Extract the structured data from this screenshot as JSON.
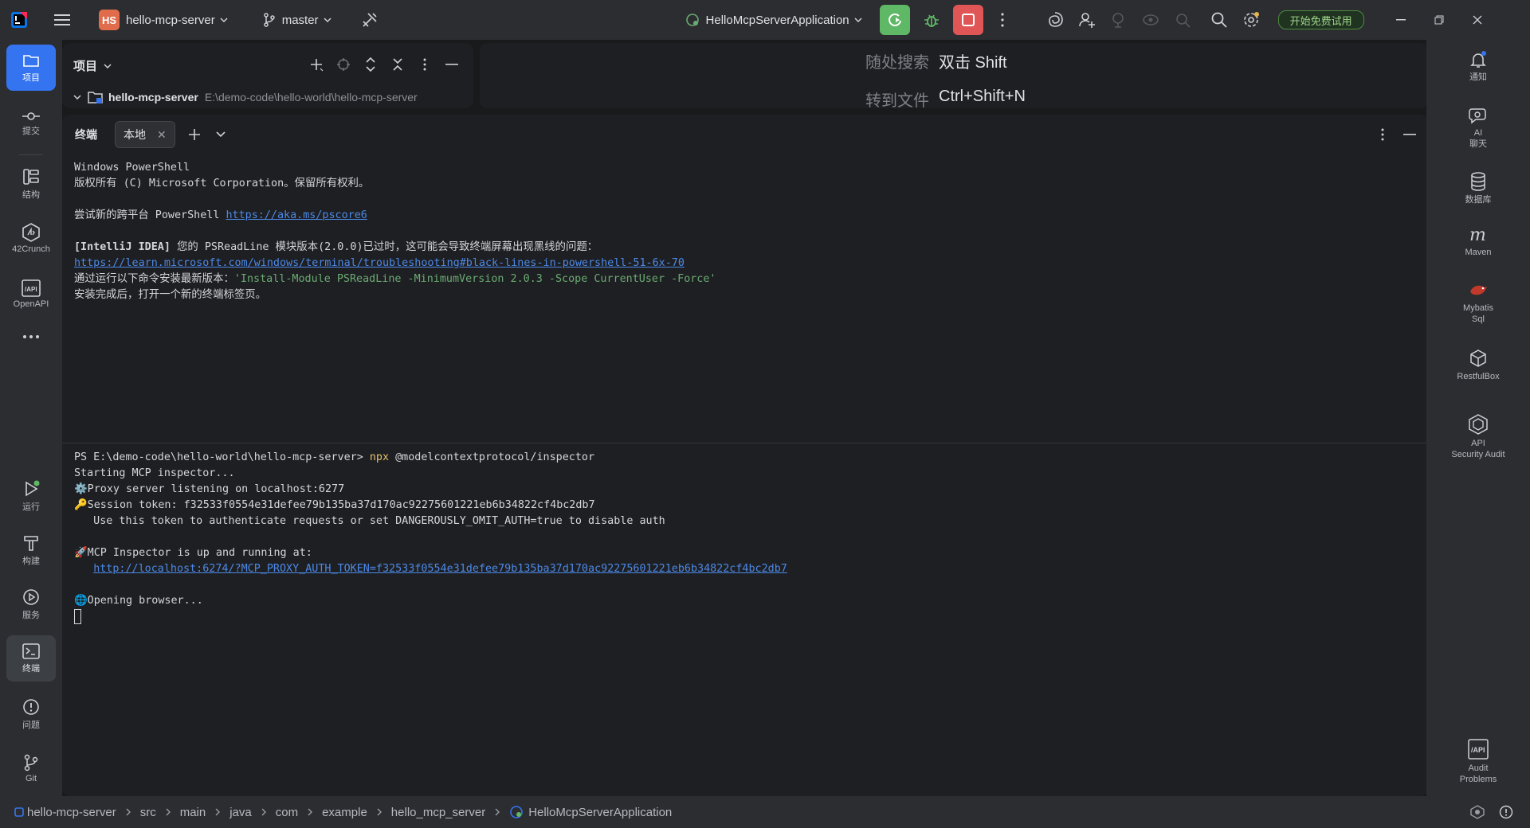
{
  "titlebar": {
    "project_badge": "HS",
    "project_name": "hello-mcp-server",
    "branch": "master",
    "run_config": "HelloMcpServerApplication",
    "trial_label": "开始免费试用"
  },
  "left_tools": {
    "project": "项目",
    "commit": "提交",
    "structure": "结构",
    "crunch": "42Crunch",
    "openapi": "OpenAPI",
    "run": "运行",
    "build": "构建",
    "services": "服务",
    "terminal": "终端",
    "problems": "问题",
    "git": "Git"
  },
  "right_tools": {
    "notifications": "通知",
    "ai_chat_1": "AI",
    "ai_chat_2": "聊天",
    "database": "数据库",
    "maven": "Maven",
    "mybatis_1": "Mybatis",
    "mybatis_2": "Sql",
    "restfulbox": "RestfulBox",
    "api_audit_1": "API",
    "api_audit_2": "Security Audit",
    "audit_problems_1": "Audit",
    "audit_problems_2": "Problems"
  },
  "project_panel": {
    "title": "项目",
    "root_name": "hello-mcp-server",
    "root_path": "E:\\demo-code\\hello-world\\hello-mcp-server"
  },
  "hints": {
    "search_label": "随处搜索",
    "search_key": "双击 Shift",
    "goto_label": "转到文件",
    "goto_key": "Ctrl+Shift+N"
  },
  "terminal": {
    "title": "终端",
    "tab_label": "本地",
    "line1": "Windows PowerShell",
    "line2": "版权所有 (C) Microsoft Corporation。保留所有权利。",
    "line3_text": "尝试新的跨平台 PowerShell ",
    "line3_link": "https://aka.ms/pscore6",
    "line4_bold": "[IntelliJ IDEA]",
    "line4_text": " 您的 PSReadLine 模块版本(2.0.0)已过时，这可能会导致终端屏幕出现黑线的问题：",
    "line5_link": "https://learn.microsoft.com/windows/terminal/troubleshooting#black-lines-in-powershell-51-6x-70",
    "line6_text": "通过运行以下命令安装最新版本：",
    "line6_str": "'Install-Module PSReadLine -MinimumVersion 2.0.3 -Scope CurrentUser -Force'",
    "line7": "安装完成后，打开一个新的终端标签页。",
    "prompt": "PS E:\\demo-code\\hello-world\\hello-mcp-server>",
    "cmd": "npx",
    "cmd_args": " @modelcontextprotocol/inspector",
    "out1": "Starting MCP inspector...",
    "out2": "⚙️Proxy server listening on localhost:6277",
    "out3": "🔑Session token: f32533f0554e31defee79b135ba37d170ac92275601221eb6b34822cf4bc2db7",
    "out4": "   Use this token to authenticate requests or set DANGEROUSLY_OMIT_AUTH=true to disable auth",
    "out5": "🚀MCP Inspector is up and running at:",
    "out6_link": "http://localhost:6274/?MCP_PROXY_AUTH_TOKEN=f32533f0554e31defee79b135ba37d170ac92275601221eb6b34822cf4bc2db7",
    "out7": "🌐Opening browser..."
  },
  "breadcrumb": [
    "hello-mcp-server",
    "src",
    "main",
    "java",
    "com",
    "example",
    "hello_mcp_server",
    "HelloMcpServerApplication"
  ],
  "colors": {
    "accent": "#3574f0",
    "run_green": "#5fb865",
    "stop_red": "#e05555",
    "link": "#4c89e8",
    "string_green": "#6aab73"
  }
}
